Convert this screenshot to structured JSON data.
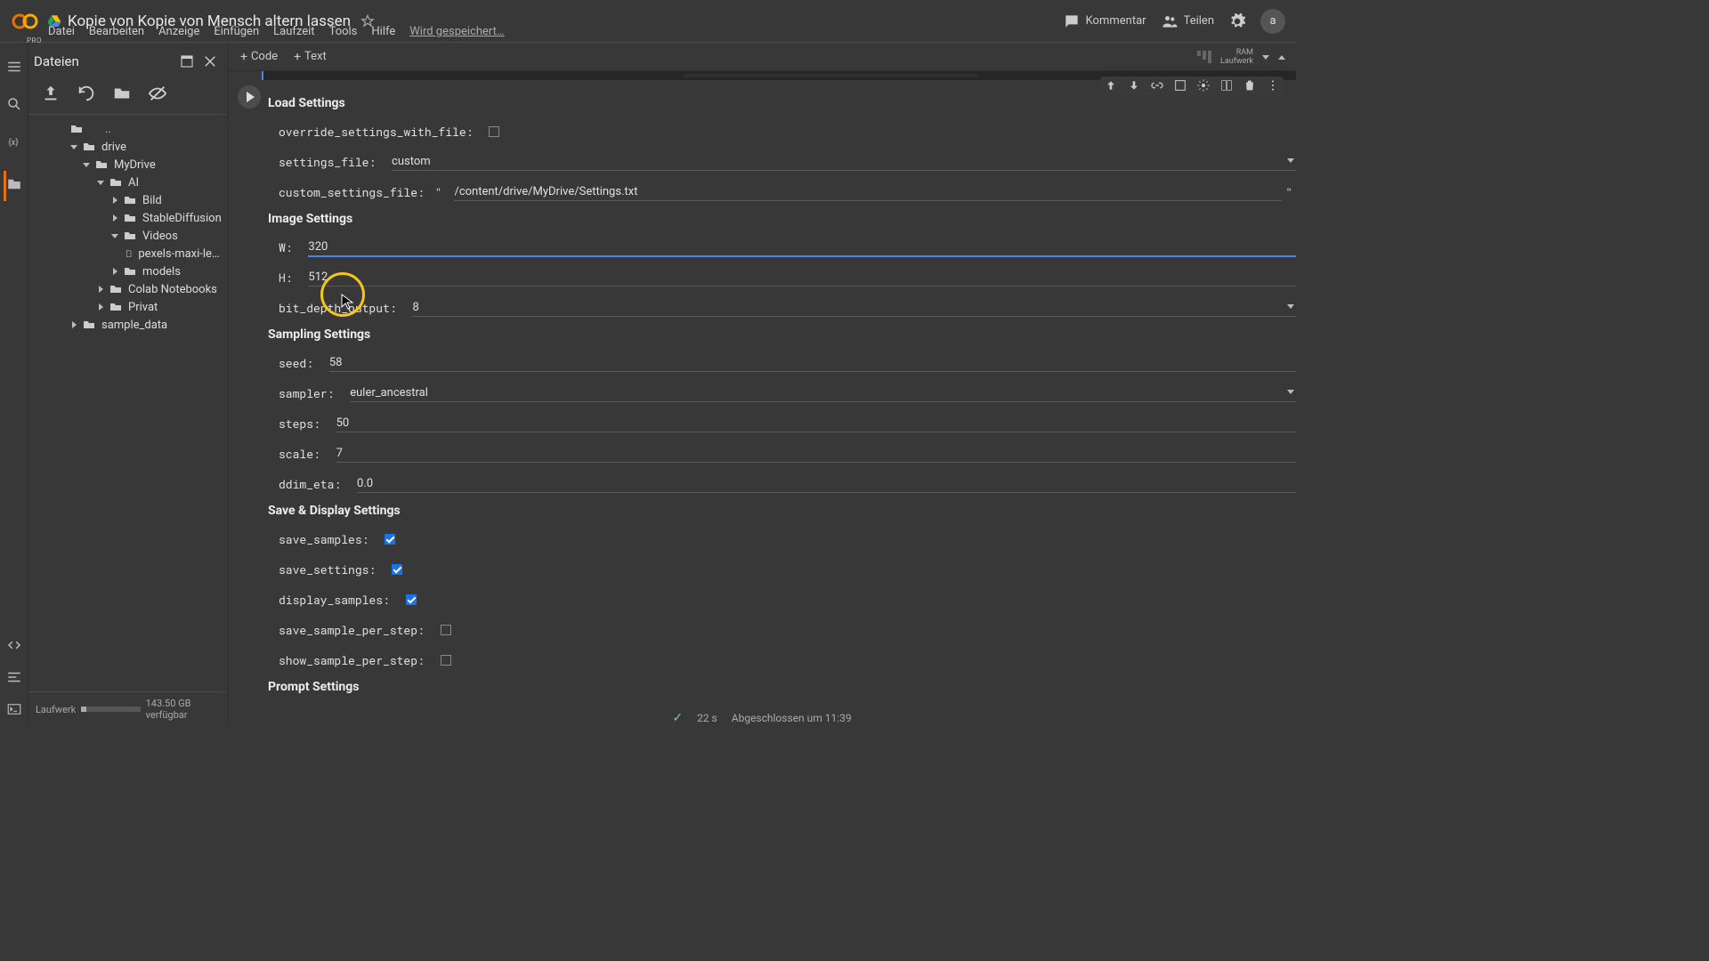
{
  "header": {
    "title": "Kopie von Kopie von Mensch altern lassen",
    "pro": "PRO",
    "comment": "Kommentar",
    "share": "Teilen"
  },
  "menubar": {
    "file": "Datei",
    "edit": "Bearbeiten",
    "view": "Anzeige",
    "insert": "Einfügen",
    "runtime": "Laufzeit",
    "tools": "Tools",
    "help": "Hilfe",
    "saving": "Wird gespeichert…"
  },
  "sidebar": {
    "title": "Dateien",
    "footer_label": "Laufwerk",
    "footer_avail": "143.50 GB verfügbar"
  },
  "tree": {
    "dots": "..",
    "drive": "drive",
    "mydrive": "MyDrive",
    "ai": "AI",
    "bild": "Bild",
    "sd": "StableDiffusion",
    "videos": "Videos",
    "video_file": "pexels-maxi-leiva-1314…",
    "models": "models",
    "colab": "Colab Notebooks",
    "privat": "Privat",
    "sample": "sample_data"
  },
  "toolbar": {
    "code": "Code",
    "text": "Text",
    "ram": "RAM",
    "disk": "Laufwerk"
  },
  "form": {
    "load_settings": "Load Settings",
    "override_label": "override_settings_with_file: ",
    "settings_file_label": "settings_file: ",
    "settings_file_val": "custom",
    "custom_settings_label": "custom_settings_file: ",
    "custom_settings_val": "/content/drive/MyDrive/Settings.txt",
    "image_settings": "Image Settings",
    "w_label": "W: ",
    "w_val": "320",
    "h_label": "H: ",
    "h_val": "512",
    "bit_depth_label": "bit_depth_output: ",
    "bit_depth_val": "8",
    "sampling_settings": "Sampling Settings",
    "seed_label": "seed: ",
    "seed_val": "58",
    "sampler_label": "sampler: ",
    "sampler_val": "euler_ancestral",
    "steps_label": "steps: ",
    "steps_val": "50",
    "scale_label": "scale: ",
    "scale_val": "7",
    "ddim_label": "ddim_eta: ",
    "ddim_val": "0.0",
    "save_display": "Save & Display Settings",
    "save_samples_label": "save_samples: ",
    "save_settings_label": "save_settings: ",
    "display_samples_label": "display_samples: ",
    "save_per_step_label": "save_sample_per_step: ",
    "show_per_step_label": "show_sample_per_step: ",
    "prompt_settings": "Prompt Settings"
  },
  "status": {
    "time": "22 s",
    "done": "Abgeschlossen um 11:39"
  },
  "avatar": "a"
}
